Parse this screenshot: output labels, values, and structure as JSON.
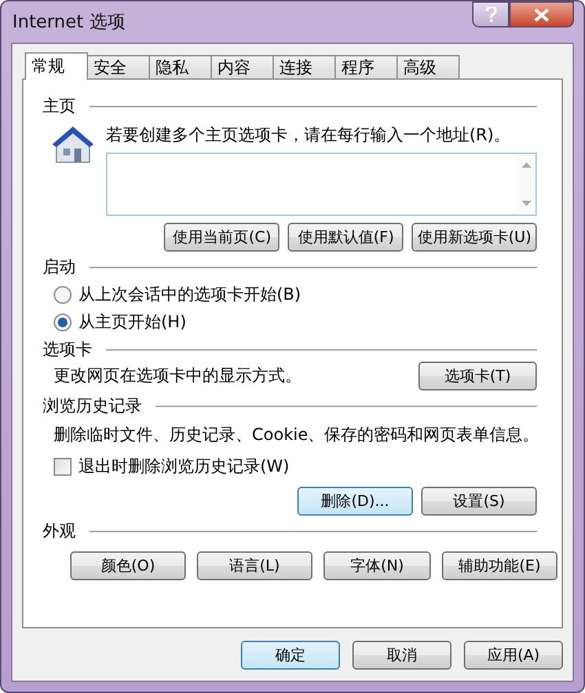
{
  "window": {
    "title": "Internet 选项"
  },
  "tabs": [
    {
      "label": "常规",
      "selected": true
    },
    {
      "label": "安全",
      "selected": false
    },
    {
      "label": "隐私",
      "selected": false
    },
    {
      "label": "内容",
      "selected": false
    },
    {
      "label": "连接",
      "selected": false
    },
    {
      "label": "程序",
      "selected": false
    },
    {
      "label": "高级",
      "selected": false
    }
  ],
  "home": {
    "heading": "主页",
    "hint": "若要创建多个主页选项卡，请在每行输入一个地址(R)。",
    "buttons": [
      {
        "label": "使用当前页(C)",
        "focused": false
      },
      {
        "label": "使用默认值(F)",
        "focused": false
      },
      {
        "label": "使用新选项卡(U)",
        "focused": false
      }
    ]
  },
  "startup": {
    "heading": "启动",
    "options": [
      {
        "label": "从上次会话中的选项卡开始(B)",
        "selected": false
      },
      {
        "label": "从主页开始(H)",
        "selected": true
      }
    ]
  },
  "tabs_section": {
    "heading": "选项卡",
    "description": "更改网页在选项卡中的显示方式。",
    "button": {
      "label": "选项卡(T)",
      "focused": false
    }
  },
  "history": {
    "heading": "浏览历史记录",
    "description": "删除临时文件、历史记录、Cookie、保存的密码和网页表单信息。",
    "checkbox": {
      "label": "退出时删除浏览历史记录(W)",
      "checked": false
    },
    "buttons": [
      {
        "label": "删除(D)...",
        "focused": true
      },
      {
        "label": "设置(S)",
        "focused": false
      }
    ]
  },
  "appearance": {
    "heading": "外观",
    "buttons": [
      {
        "label": "颜色(O)",
        "focused": false
      },
      {
        "label": "语言(L)",
        "focused": false
      },
      {
        "label": "字体(N)",
        "focused": false
      },
      {
        "label": "辅助功能(E)",
        "focused": false
      }
    ]
  },
  "footer": {
    "buttons": [
      {
        "label": "确定",
        "focused": true
      },
      {
        "label": "取消",
        "focused": false
      },
      {
        "label": "应用(A)",
        "focused": false
      }
    ]
  }
}
